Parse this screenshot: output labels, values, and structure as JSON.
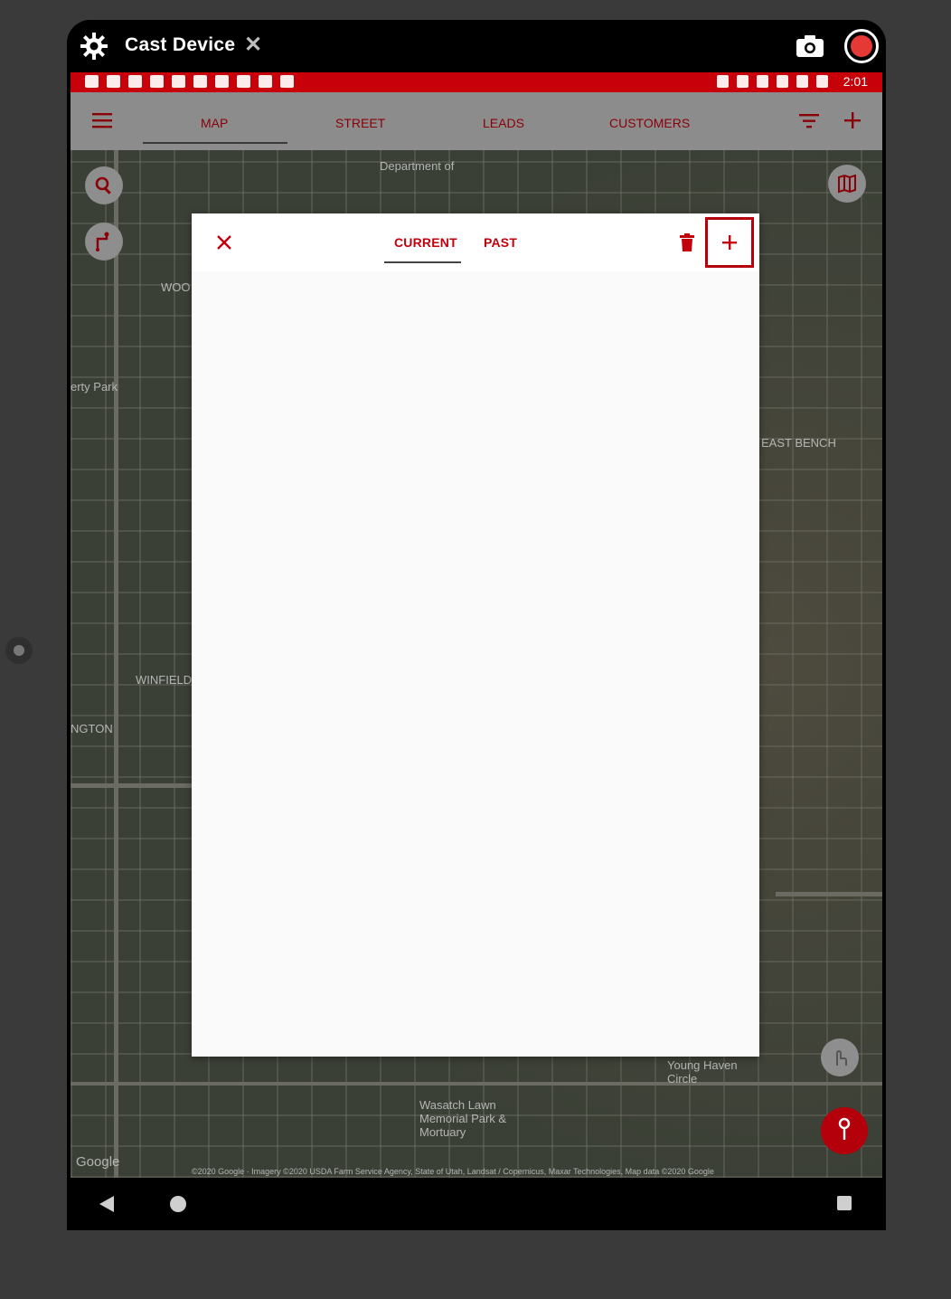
{
  "cast_bar": {
    "title": "Cast Device",
    "close_glyph": "✕"
  },
  "status_bar": {
    "time": "2:01"
  },
  "app_bar": {
    "tabs": [
      {
        "label": "MAP",
        "active": true
      },
      {
        "label": "STREET",
        "active": false
      },
      {
        "label": "LEADS",
        "active": false
      },
      {
        "label": "CUSTOMERS",
        "active": false
      }
    ]
  },
  "map": {
    "labels": [
      "Department of",
      "WOO",
      "erty Park",
      "EAST BENCH",
      "WINFIELD",
      "NGTON",
      "Young Haven Circle",
      "Wasatch Lawn Memorial Park & Mortuary",
      "Google"
    ],
    "attribution": "©2020 Google · Imagery ©2020 USDA Farm Service Agency, State of Utah, Landsat / Copernicus, Maxar Technologies, Map data ©2020 Google"
  },
  "panel": {
    "tabs": [
      {
        "label": "CURRENT",
        "active": true
      },
      {
        "label": "PAST",
        "active": false
      }
    ]
  },
  "colors": {
    "accent_red": "#c4000d",
    "status_bar": "#c8000a",
    "app_bar": "#8c8c8c"
  },
  "icons": [
    "gear-icon",
    "close-icon",
    "camera-icon",
    "record-icon",
    "menu-icon",
    "filter-icon",
    "plus-icon",
    "search-icon",
    "route-icon",
    "map-layers-icon",
    "trash-icon",
    "add-icon",
    "touch-icon",
    "pin-icon",
    "back-icon",
    "home-icon",
    "recent-apps-icon"
  ]
}
